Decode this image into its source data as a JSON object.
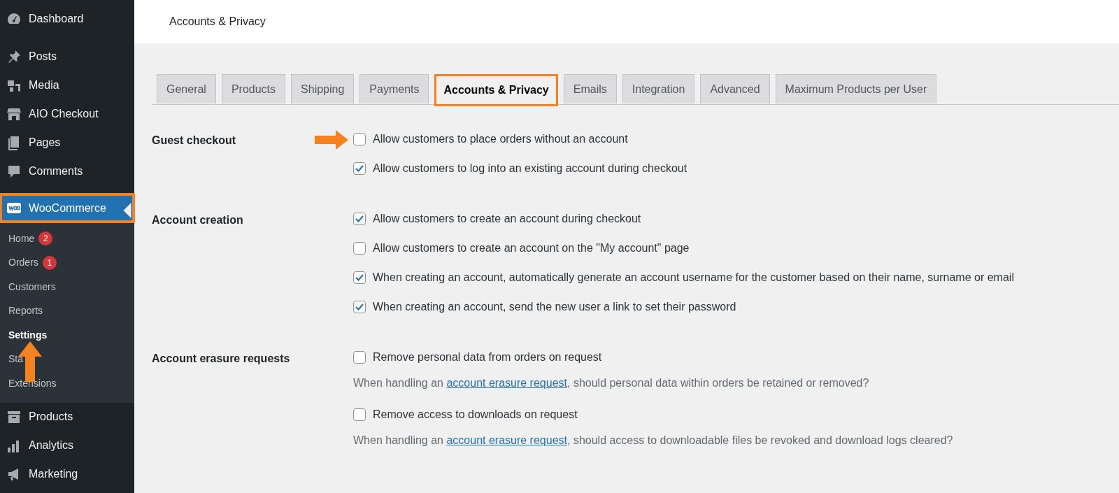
{
  "sidebar": {
    "items": [
      {
        "label": "Dashboard",
        "selected": false,
        "highlighted": false
      },
      {
        "label": "Posts",
        "selected": false,
        "highlighted": false
      },
      {
        "label": "Media",
        "selected": false,
        "highlighted": false
      },
      {
        "label": "AIO Checkout",
        "selected": false,
        "highlighted": false
      },
      {
        "label": "Pages",
        "selected": false,
        "highlighted": false
      },
      {
        "label": "Comments",
        "selected": false,
        "highlighted": false
      },
      {
        "label": "WooCommerce",
        "selected": true,
        "highlighted": true,
        "children": [
          {
            "label": "Home",
            "badge": "2",
            "selected": false
          },
          {
            "label": "Orders",
            "badge": "1",
            "selected": false
          },
          {
            "label": "Customers",
            "selected": false
          },
          {
            "label": "Reports",
            "selected": false
          },
          {
            "label": "Settings",
            "selected": true
          },
          {
            "label": "Sta",
            "selected": false
          },
          {
            "label": "Extensions",
            "selected": false
          }
        ]
      },
      {
        "label": "Products",
        "selected": false,
        "highlighted": false
      },
      {
        "label": "Analytics",
        "selected": false,
        "highlighted": false
      },
      {
        "label": "Marketing",
        "selected": false,
        "highlighted": false
      }
    ],
    "pointer_arrow": true
  },
  "header": {
    "title": "Accounts & Privacy"
  },
  "tabs": [
    {
      "label": "General",
      "selected": false,
      "highlighted": false
    },
    {
      "label": "Products",
      "selected": false,
      "highlighted": false
    },
    {
      "label": "Shipping",
      "selected": false,
      "highlighted": false
    },
    {
      "label": "Payments",
      "selected": false,
      "highlighted": false
    },
    {
      "label": "Accounts & Privacy",
      "selected": true,
      "highlighted": true
    },
    {
      "label": "Emails",
      "selected": false,
      "highlighted": false
    },
    {
      "label": "Integration",
      "selected": false,
      "highlighted": false
    },
    {
      "label": "Advanced",
      "selected": false,
      "highlighted": false
    },
    {
      "label": "Maximum Products per User",
      "selected": false,
      "highlighted": false
    }
  ],
  "sections": [
    {
      "label": "Guest checkout",
      "options": [
        {
          "label": "Allow customers to place orders without an account",
          "checked": false,
          "pointer_arrow": true
        },
        {
          "label": "Allow customers to log into an existing account during checkout",
          "checked": true
        }
      ]
    },
    {
      "label": "Account creation",
      "options": [
        {
          "label": "Allow customers to create an account during checkout",
          "checked": true
        },
        {
          "label": "Allow customers to create an account on the \"My account\" page",
          "checked": false
        },
        {
          "label": "When creating an account, automatically generate an account username for the customer based on their name, surname or email",
          "checked": true
        },
        {
          "label": "When creating an account, send the new user a link to set their password",
          "checked": true
        }
      ]
    },
    {
      "label": "Account erasure requests",
      "options": [
        {
          "label": "Remove personal data from orders on request",
          "checked": false,
          "description": {
            "before": "When handling an ",
            "link": "account erasure request",
            "after": ", should personal data within orders be retained or removed?"
          }
        },
        {
          "label": "Remove access to downloads on request",
          "checked": false,
          "description": {
            "before": "When handling an ",
            "link": "account erasure request",
            "after": ", should access to downloadable files be revoked and download logs cleared?"
          }
        }
      ]
    }
  ]
}
